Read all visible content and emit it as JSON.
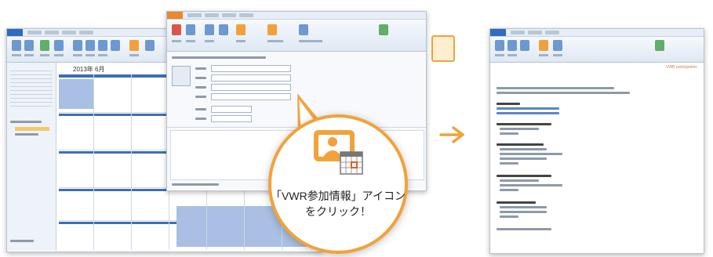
{
  "calendar_window": {
    "month_label": "2013年 6月"
  },
  "callout": {
    "icon": "vwr-participation-info-icon",
    "caption_line1": "「VWR参加情報」アイコン",
    "caption_line2": "をクリック！",
    "accent_color": "#f2a23a"
  },
  "result_window": {
    "header_badge": "VWR participation"
  },
  "arrow": {
    "icon": "right-arrow-icon",
    "color": "#f2a23a"
  }
}
